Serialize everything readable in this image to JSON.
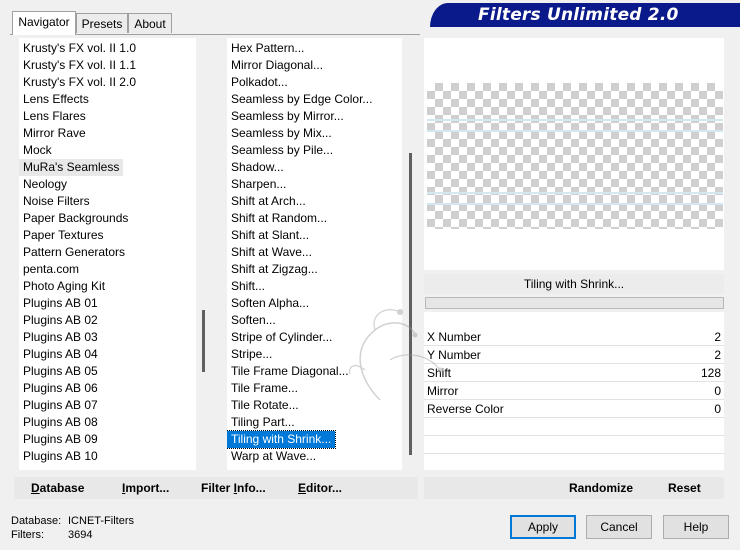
{
  "tabs": [
    "Navigator",
    "Presets",
    "About"
  ],
  "app_title": "Filters Unlimited 2.0",
  "categories": [
    "Krusty's FX vol. II 1.0",
    "Krusty's FX vol. II 1.1",
    "Krusty's FX vol. II 2.0",
    "Lens Effects",
    "Lens Flares",
    "Mirror Rave",
    "Mock",
    "MuRa's Seamless",
    "Neology",
    "Noise Filters",
    "Paper Backgrounds",
    "Paper Textures",
    "Pattern Generators",
    "penta.com",
    "Photo Aging Kit",
    "Plugins AB 01",
    "Plugins AB 02",
    "Plugins AB 03",
    "Plugins AB 04",
    "Plugins AB 05",
    "Plugins AB 06",
    "Plugins AB 07",
    "Plugins AB 08",
    "Plugins AB 09",
    "Plugins AB 10"
  ],
  "selected_category": "MuRa's Seamless",
  "filters": [
    "Hex Pattern...",
    "Mirror Diagonal...",
    "Polkadot...",
    "Seamless by Edge Color...",
    "Seamless by Mirror...",
    "Seamless by Mix...",
    "Seamless by Pile...",
    "Shadow...",
    "Sharpen...",
    "Shift at Arch...",
    "Shift at Random...",
    "Shift at Slant...",
    "Shift at Wave...",
    "Shift at Zigzag...",
    "Shift...",
    "Soften Alpha...",
    "Soften...",
    "Stripe of Cylinder...",
    "Stripe...",
    "Tile Frame Diagonal...",
    "Tile Frame...",
    "Tile Rotate...",
    "Tiling Part...",
    "Tiling with Shrink...",
    "Warp at Wave..."
  ],
  "selected_filter": "Tiling with Shrink...",
  "current_filter_name": "Tiling with Shrink...",
  "params": [
    {
      "label": "X Number",
      "value": "2"
    },
    {
      "label": "Y Number",
      "value": "2"
    },
    {
      "label": "Shift",
      "value": "128"
    },
    {
      "label": "Mirror",
      "value": "0"
    },
    {
      "label": "Reverse Color",
      "value": "0"
    }
  ],
  "left_buttons": {
    "database": {
      "u": "D",
      "rest": "atabase"
    },
    "import": {
      "u": "I",
      "rest": "mport..."
    },
    "filter_info": {
      "pre": "Filter ",
      "u": "I",
      "rest": "nfo..."
    },
    "editor": {
      "u": "E",
      "rest": "ditor..."
    }
  },
  "right_buttons": {
    "randomize": "Randomize",
    "reset": "Reset"
  },
  "status": {
    "database_label": "Database:",
    "database_value": "ICNET-Filters",
    "filters_label": "Filters:",
    "filters_value": "3694"
  },
  "dialog_buttons": {
    "apply": "Apply",
    "cancel": "Cancel",
    "help": "Help"
  },
  "colors": {
    "banner": "#0a1a8a",
    "selection": "#0078d7"
  }
}
